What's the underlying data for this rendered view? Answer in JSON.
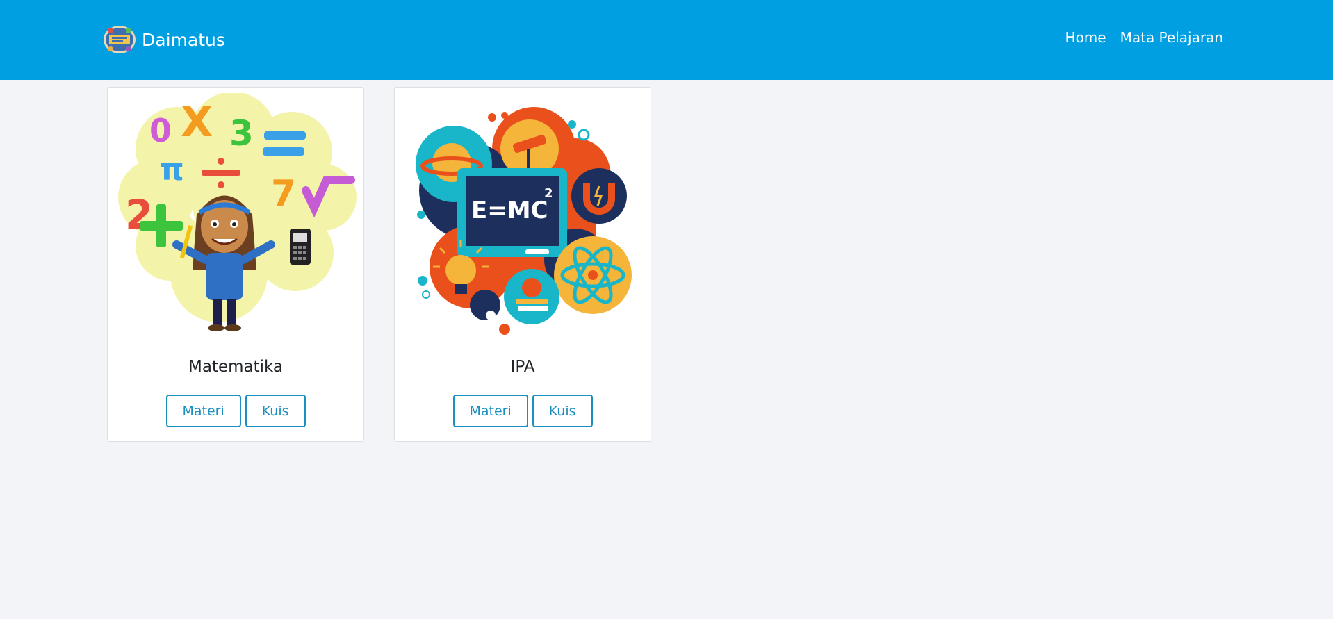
{
  "header": {
    "brand": "Daimatus",
    "nav": [
      {
        "label": "Home"
      },
      {
        "label": "Mata Pelajaran"
      }
    ]
  },
  "subjects": [
    {
      "title": "Matematika",
      "image": "math-girl-illustration",
      "buttons": [
        "Materi",
        "Kuis"
      ]
    },
    {
      "title": "IPA",
      "image": "science-illustration",
      "buttons": [
        "Materi",
        "Kuis"
      ]
    }
  ],
  "colors": {
    "navbar": "#009fe2",
    "background": "#f3f4f8",
    "button_outline": "#1b8fbf"
  }
}
